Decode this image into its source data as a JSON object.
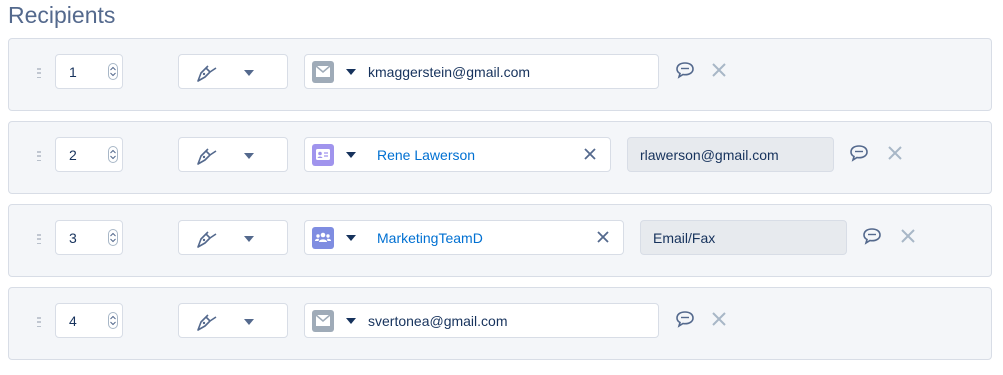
{
  "page": {
    "title": "Recipients"
  },
  "colors": {
    "email_icon_bg": "#9fabb8",
    "contact_icon_bg": "#a094ed",
    "group_icon_bg": "#7f8de1",
    "link": "#0070d2"
  },
  "recipients": [
    {
      "order": "1",
      "action_icon": "signer-pen-icon",
      "type_icon": "email-icon",
      "value": "kmaggerstein@gmail.com",
      "linked": false,
      "extra": ""
    },
    {
      "order": "2",
      "action_icon": "signer-pen-icon",
      "type_icon": "contact-icon",
      "value": "Rene Lawerson",
      "linked": true,
      "extra": "rlawerson@gmail.com"
    },
    {
      "order": "3",
      "action_icon": "signer-pen-icon",
      "type_icon": "group-icon",
      "value": "MarketingTeamD",
      "linked": true,
      "extra": "Email/Fax"
    },
    {
      "order": "4",
      "action_icon": "signer-pen-icon",
      "type_icon": "email-icon",
      "value": "svertonea@gmail.com",
      "linked": false,
      "extra": ""
    }
  ]
}
